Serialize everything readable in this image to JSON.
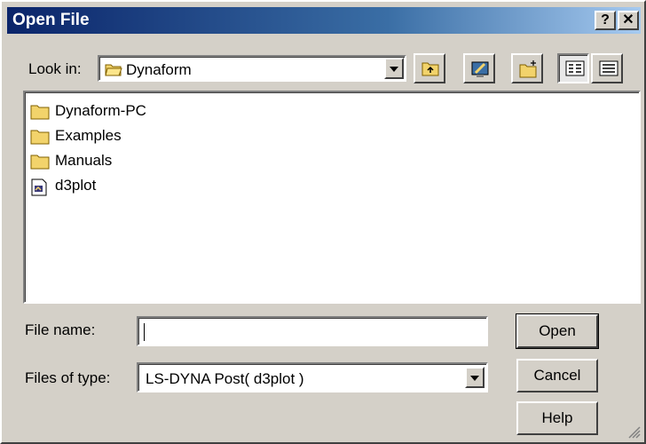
{
  "window": {
    "title": "Open File",
    "help_label": "?",
    "close_label": "✕"
  },
  "look_in": {
    "label": "Look in:",
    "value": "Dynaform"
  },
  "toolbar": {
    "icons": [
      "up-folder-icon",
      "desktop-icon",
      "new-folder-icon",
      "list-view-icon",
      "details-view-icon"
    ]
  },
  "files": [
    {
      "name": "Dynaform-PC",
      "type": "folder"
    },
    {
      "name": "Examples",
      "type": "folder"
    },
    {
      "name": "Manuals",
      "type": "folder"
    },
    {
      "name": "d3plot",
      "type": "file"
    }
  ],
  "file_name": {
    "label": "File name:",
    "value": ""
  },
  "file_type": {
    "label": "Files of type:",
    "value": "LS-DYNA Post( d3plot )"
  },
  "buttons": {
    "open": "Open",
    "cancel": "Cancel",
    "help": "Help"
  },
  "colors": {
    "title_start": "#0a246a",
    "title_end": "#a6caf0",
    "folder": "#f2d36b",
    "face": "#d4d0c8"
  }
}
